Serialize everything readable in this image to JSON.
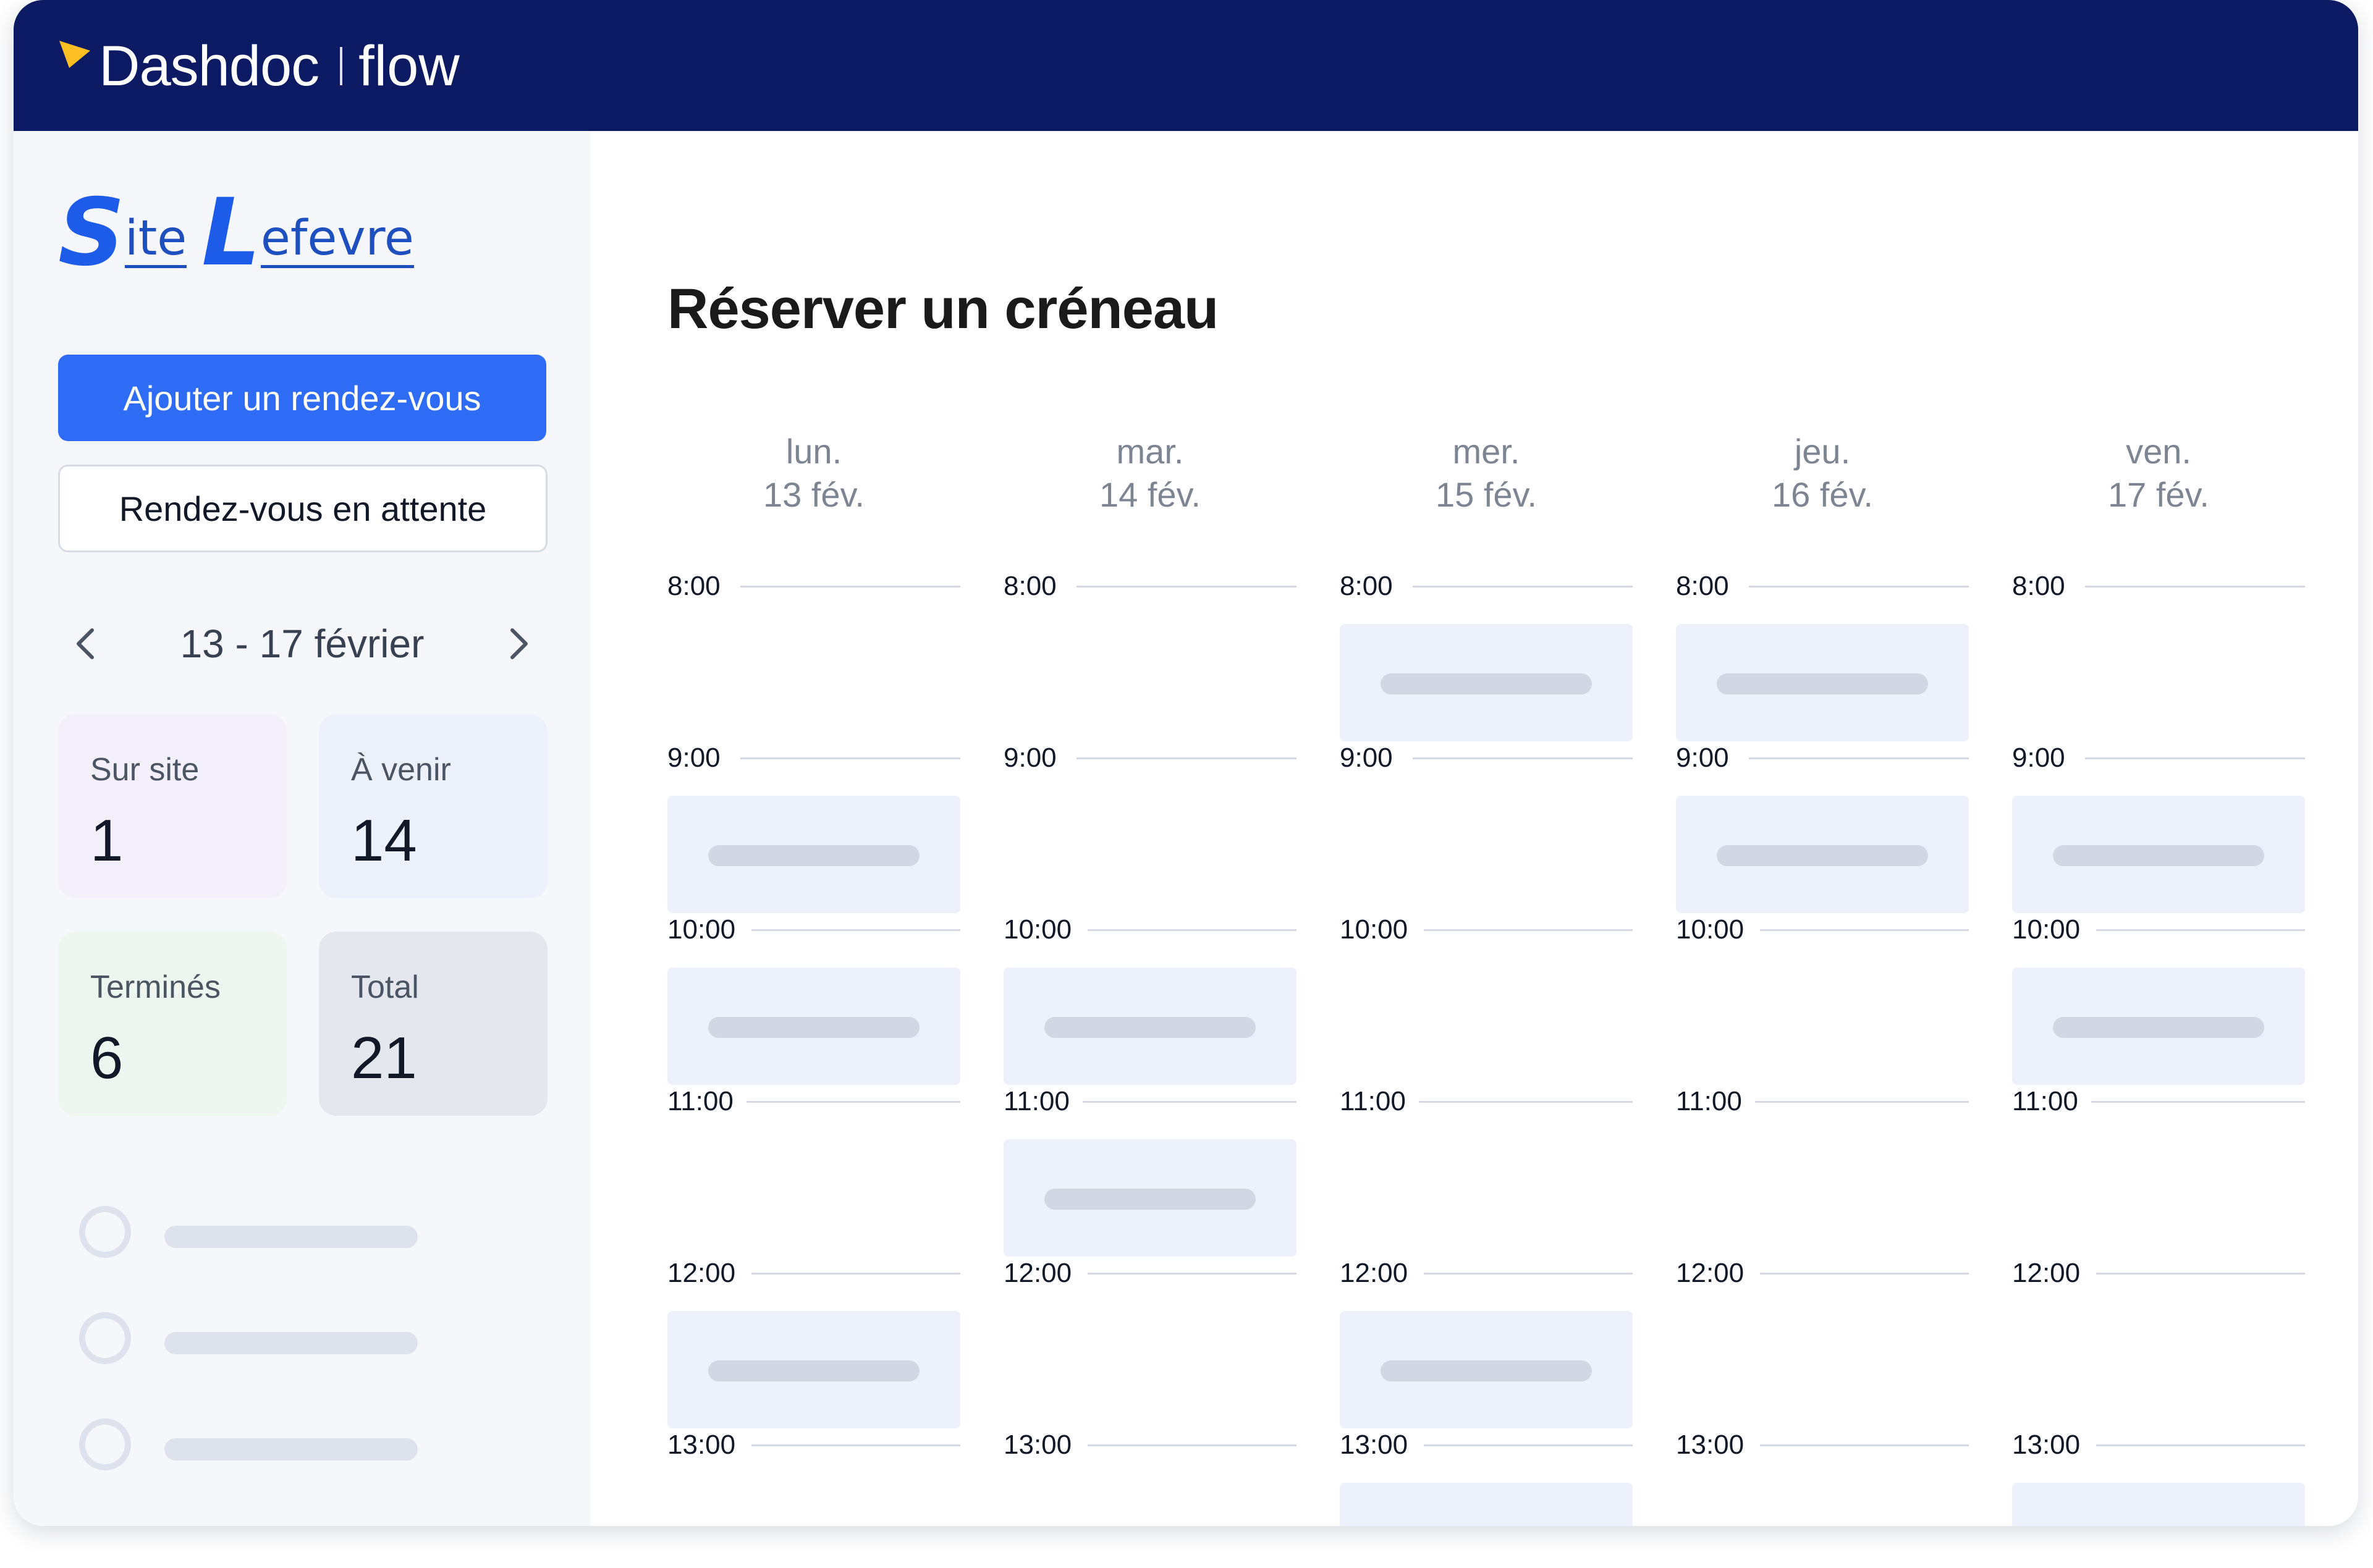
{
  "brand": {
    "name": "Dashdoc",
    "product": "flow",
    "accent_color": "#fbbf24",
    "bar_color": "#0b1a63"
  },
  "site": {
    "logo_text": "Site Lefevre",
    "initial_1": "S",
    "rest_1": "ite",
    "initial_2": "L",
    "rest_2": "efevre"
  },
  "sidebar": {
    "primary_button": "Ajouter un rendez-vous",
    "secondary_button": "Rendez-vous en attente",
    "date_range": "13 - 17 février",
    "prev_icon": "chevron-left-icon",
    "next_icon": "chevron-right-icon",
    "stats": [
      {
        "label": "Sur site",
        "value": "1"
      },
      {
        "label": "À venir",
        "value": "14"
      },
      {
        "label": "Terminés",
        "value": "6"
      },
      {
        "label": "Total",
        "value": "21"
      }
    ]
  },
  "main": {
    "title": "Réserver un créneau",
    "days": [
      {
        "dow": "lun.",
        "date": "13 fév."
      },
      {
        "dow": "mar.",
        "date": "14 fév."
      },
      {
        "dow": "mer.",
        "date": "15 fév."
      },
      {
        "dow": "jeu.",
        "date": "16 fév."
      },
      {
        "dow": "ven.",
        "date": "17 fév."
      }
    ],
    "times": [
      "8:00",
      "9:00",
      "10:00",
      "11:00",
      "12:00",
      "13:00"
    ]
  }
}
